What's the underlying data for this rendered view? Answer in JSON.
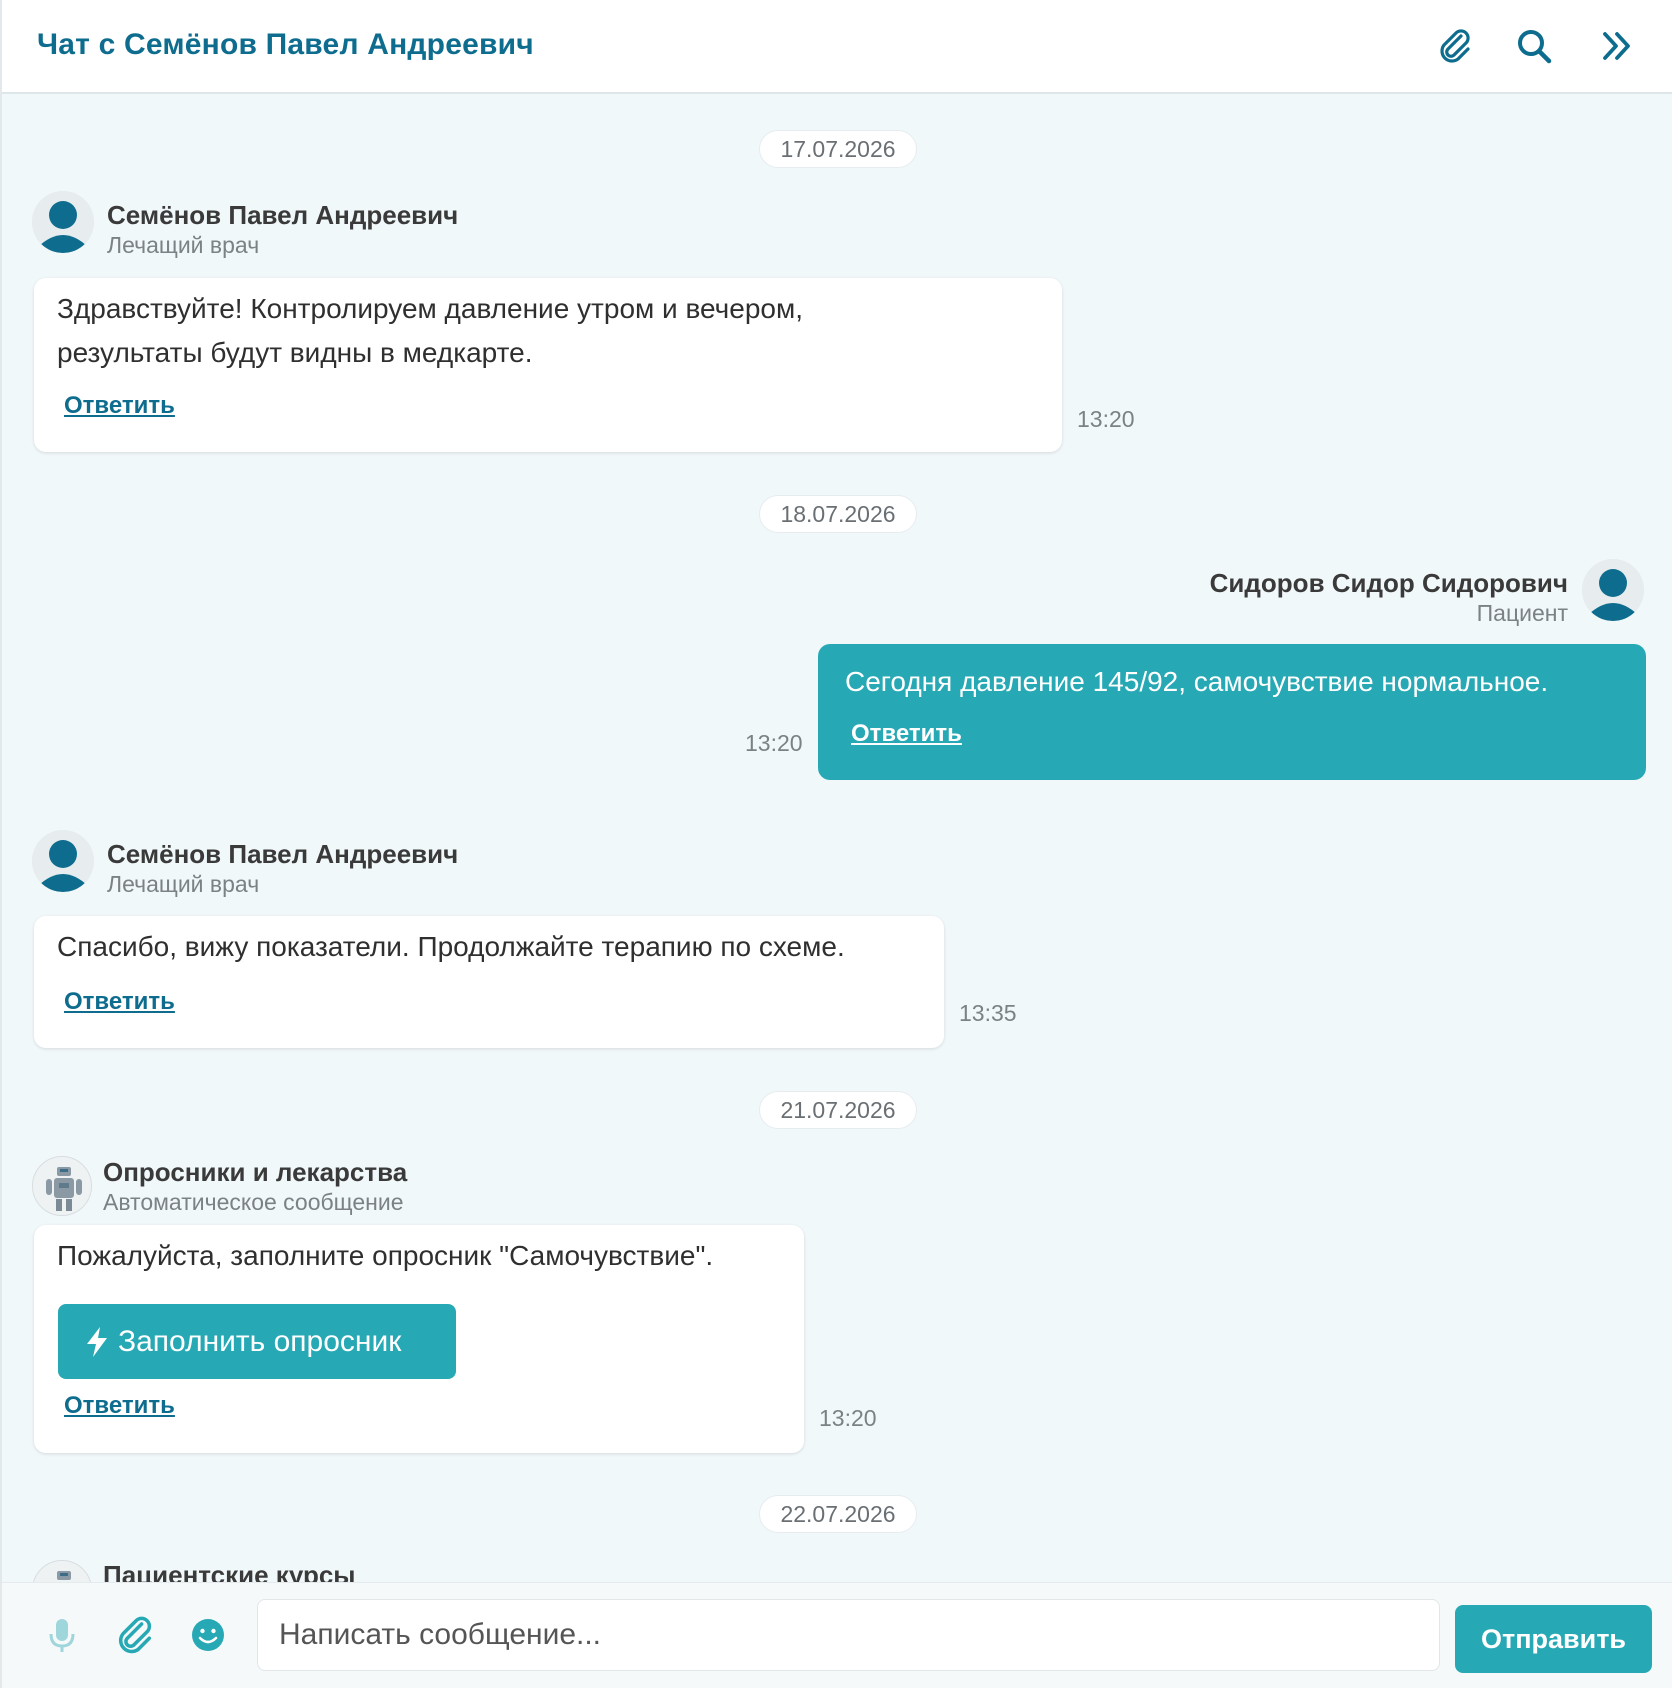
{
  "header": {
    "title": "Чат с Семёнов Павел Андреевич",
    "icons": [
      "paperclip-icon",
      "search-icon",
      "double-chevron-right-icon"
    ]
  },
  "colors": {
    "accent": "#27a9b5",
    "brand_dark": "#0e6d8e",
    "chat_bg": "#f1f8fa"
  },
  "messages": [
    {
      "date": "17.07.2026",
      "sender": "Семёнов Павел Андреевич",
      "role": "Лечащий врач",
      "text_lines": [
        "Здравствуйте! Контролируем давление утром и вечером,",
        "результаты будут видны в медкарте."
      ],
      "reply": "Ответить",
      "time": "13:20"
    },
    {
      "date": "18.07.2026",
      "sender": "Сидоров Сидор Сидорович",
      "role": "Пациент",
      "text": "Сегодня давление 145/92, самочувствие нормальное.",
      "reply": "Ответить",
      "time": "13:20"
    },
    {
      "sender": "Семёнов Павел Андреевич",
      "role": "Лечащий врач",
      "text": "Спасибо, вижу показатели. Продолжайте терапию по схеме.",
      "reply": "Ответить",
      "time": "13:35"
    },
    {
      "date": "21.07.2026",
      "sender": "Опросники и лекарства",
      "role": "Автоматическое сообщение",
      "text": "Пожалуйста, заполните опросник \"Самочувствие\".",
      "button": "Заполнить опросник",
      "reply": "Ответить",
      "time": "13:20"
    },
    {
      "date": "22.07.2026",
      "sender": "Пациентские курсы"
    }
  ],
  "footer": {
    "placeholder": "Написать сообщение...",
    "send_label": "Отправить",
    "icons": [
      "microphone-icon",
      "paperclip-icon",
      "emoji-icon"
    ]
  }
}
